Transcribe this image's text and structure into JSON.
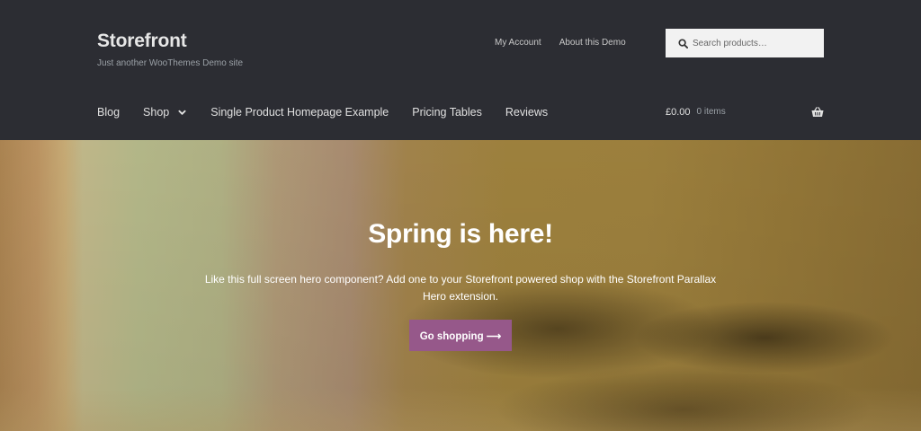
{
  "site": {
    "title": "Storefront",
    "description": "Just another WooThemes Demo site"
  },
  "secondary_nav": {
    "items": [
      {
        "label": "My Account"
      },
      {
        "label": "About this Demo"
      }
    ]
  },
  "search": {
    "placeholder": "Search products…",
    "icon": "search-icon"
  },
  "primary_nav": {
    "items": [
      {
        "label": "Blog"
      },
      {
        "label": "Shop",
        "has_dropdown": true,
        "icon": "chevron-down-icon"
      },
      {
        "label": "Single Product Homepage Example"
      },
      {
        "label": "Pricing Tables"
      },
      {
        "label": "Reviews"
      }
    ]
  },
  "cart": {
    "amount": "£0.00",
    "count": "0 items",
    "icon": "basket-icon"
  },
  "hero": {
    "title": "Spring is here!",
    "text": "Like this full screen hero component? Add one to your Storefront powered shop with the Storefront Parallax Hero extension.",
    "button_label": "Go shopping ⟶"
  },
  "colors": {
    "header_bg": "#2c2d33",
    "accent_button": "#96588a",
    "search_bg": "#f2f2f2"
  }
}
